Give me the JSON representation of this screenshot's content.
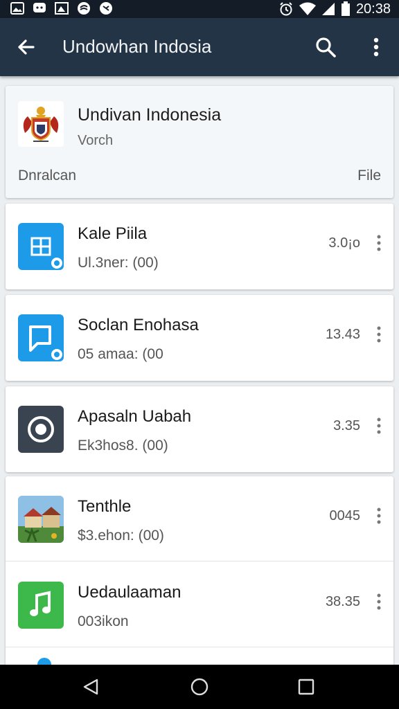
{
  "status_bar": {
    "time": "20:38",
    "left_icons": [
      "gallery-icon",
      "messenger-icon",
      "image-icon",
      "music-app-icon",
      "sync-icon"
    ],
    "right_icons": [
      "alarm-icon",
      "wifi-icon",
      "signal-icon",
      "battery-icon"
    ]
  },
  "app_bar": {
    "title": "Undowhan Indosia"
  },
  "header_card": {
    "title": "Undivan Indonesia",
    "subtitle": "Vorch",
    "left_label": "Dnralcan",
    "right_label": "File"
  },
  "items": [
    {
      "title": "Kale Piila",
      "subtitle": "Ul.3ner: (00)",
      "value": "3.0¡o",
      "icon": "windows-icon",
      "color": "#1e9be8"
    },
    {
      "title": "Soclan Enohasa",
      "subtitle": "05 amaa: (00",
      "value": "13.43",
      "icon": "chat-icon",
      "color": "#1e9be8"
    },
    {
      "title": "Apasaln Uabah",
      "subtitle": "Ek3hos8. (00)",
      "value": "3.35",
      "icon": "record-icon",
      "color": "#3a4350"
    },
    {
      "title": "Tenthle",
      "subtitle": "$3.ehon: (00)",
      "value": "0045",
      "icon": "landscape-photo-icon",
      "color": "#6a8f4a"
    },
    {
      "title": "Uedaulaaman",
      "subtitle": "003ikon",
      "value": "38.35",
      "icon": "music-note-icon",
      "color": "#3db84b"
    }
  ],
  "colors": {
    "app_bar": "#243447",
    "status_bar": "#141c28",
    "accent_blue": "#1e9be8",
    "accent_green": "#3db84b"
  }
}
